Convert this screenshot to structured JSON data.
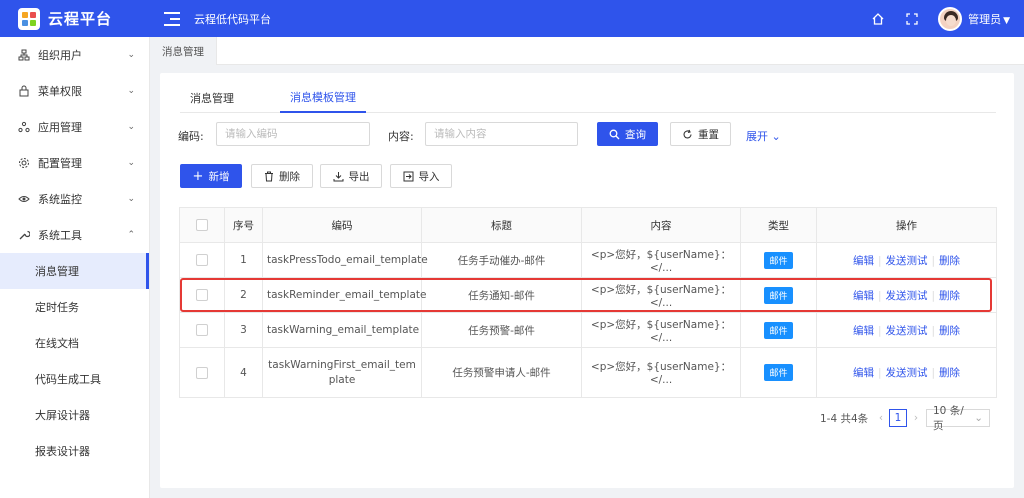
{
  "header": {
    "logo_text": "云程平台",
    "title": "云程低代码平台",
    "user_name": "管理员"
  },
  "sidebar": {
    "items": [
      {
        "label": "组织用户",
        "icon": "org-icon"
      },
      {
        "label": "菜单权限",
        "icon": "lock-icon"
      },
      {
        "label": "应用管理",
        "icon": "app-icon"
      },
      {
        "label": "配置管理",
        "icon": "gear-icon"
      },
      {
        "label": "系统监控",
        "icon": "eye-icon"
      },
      {
        "label": "系统工具",
        "icon": "tool-icon"
      }
    ],
    "sub_items": [
      "消息管理",
      "定时任务",
      "在线文档",
      "代码生成工具",
      "大屏设计器",
      "报表设计器"
    ]
  },
  "breadcrumb_tab": "消息管理",
  "subtabs": [
    "消息管理",
    "消息模板管理"
  ],
  "filters": {
    "code_label": "编码:",
    "code_placeholder": "请输入编码",
    "content_label": "内容:",
    "content_placeholder": "请输入内容",
    "search": "查询",
    "reset": "重置",
    "expand": "展开"
  },
  "toolbar": {
    "add": "新增",
    "delete": "删除",
    "export": "导出",
    "import": "导入"
  },
  "table": {
    "headers": [
      "序号",
      "编码",
      "标题",
      "内容",
      "类型",
      "操作"
    ],
    "rows": [
      {
        "no": "1",
        "code": "taskPressTodo_email_template",
        "title": "任务手动催办-邮件",
        "content": "<p>您好，${userName}：</...",
        "type": "邮件"
      },
      {
        "no": "2",
        "code": "taskReminder_email_template",
        "title": "任务通知-邮件",
        "content": "<p>您好，${userName}：</...",
        "type": "邮件"
      },
      {
        "no": "3",
        "code": "taskWarning_email_template",
        "title": "任务预警-邮件",
        "content": "<p>您好，${userName}：</...",
        "type": "邮件"
      },
      {
        "no": "4",
        "code": "taskWarningFirst_email_template",
        "title": "任务预警申请人-邮件",
        "content": "<p>您好，${userName}：</...",
        "type": "邮件"
      }
    ],
    "ops": {
      "edit": "编辑",
      "send_test": "发送测试",
      "delete": "删除"
    }
  },
  "pagination": {
    "total": "1-4 共4条",
    "current_page": "1",
    "page_size": "10 条/页"
  },
  "colors": {
    "brand": "#2f54eb",
    "tag": "#1890ff",
    "highlight": "#e53935"
  }
}
